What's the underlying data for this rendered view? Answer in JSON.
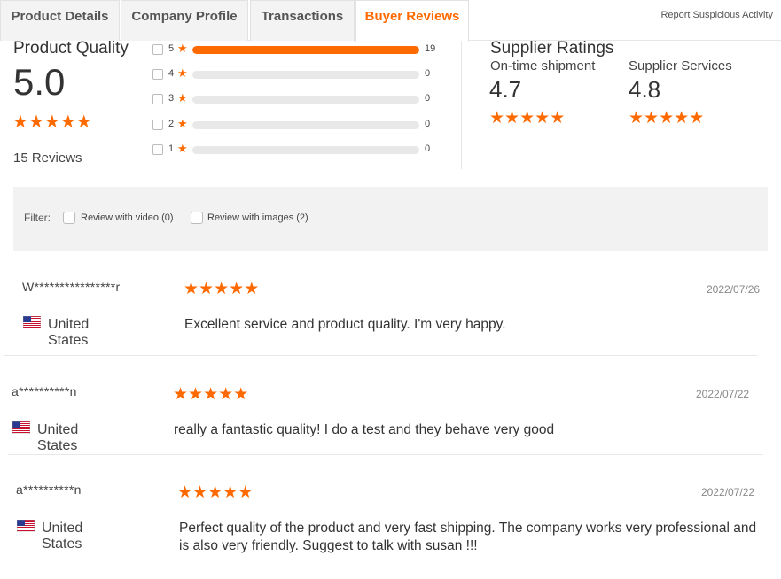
{
  "tabs": [
    {
      "label": "Product Details"
    },
    {
      "label": "Company Profile"
    },
    {
      "label": "Transactions"
    },
    {
      "label": "Buyer Reviews"
    }
  ],
  "report_link": "Report Suspicious Activity",
  "product_quality": {
    "title": "Product Quality",
    "score": "5.0",
    "stars": 5,
    "reviews_count": "15 Reviews"
  },
  "distribution": [
    {
      "stars": "5",
      "value": "19",
      "fraction": 1.0
    },
    {
      "stars": "4",
      "value": "0",
      "fraction": 0.0
    },
    {
      "stars": "3",
      "value": "0",
      "fraction": 0.0
    },
    {
      "stars": "2",
      "value": "0",
      "fraction": 0.0
    },
    {
      "stars": "1",
      "value": "0",
      "fraction": 0.0
    }
  ],
  "supplier_ratings": {
    "title": "Supplier Ratings",
    "items": [
      {
        "label": "On-time shipment",
        "score": "4.7",
        "stars": 5
      },
      {
        "label": "Supplier Services",
        "score": "4.8",
        "stars": 5
      }
    ]
  },
  "filter": {
    "label": "Filter:",
    "options": [
      {
        "label": "Review with video (0)",
        "checked": false
      },
      {
        "label": "Review with images (2)",
        "checked": false
      }
    ]
  },
  "reviews": [
    {
      "user": "W****************r",
      "country": "United States",
      "date": "2022/07/26",
      "rating": 5,
      "text": "Excellent service and product quality. I'm very happy."
    },
    {
      "user": "a**********n",
      "country": "United States",
      "date": "2022/07/22",
      "rating": 5,
      "text": "really a fantastic quality! I do a test and they behave very good"
    },
    {
      "user": "a**********n",
      "country": "United States",
      "date": "2022/07/22",
      "rating": 5,
      "text": "Perfect quality of the product and very fast shipping. The company works very professional and is also very friendly. Suggest to talk with susan !!!"
    }
  ],
  "colors": {
    "accent": "#ff6a00",
    "track": "#e8e8e8",
    "filter_bg": "#f2f2f2"
  },
  "icons": {
    "star": "star-icon",
    "flag": "us-flag-icon"
  }
}
